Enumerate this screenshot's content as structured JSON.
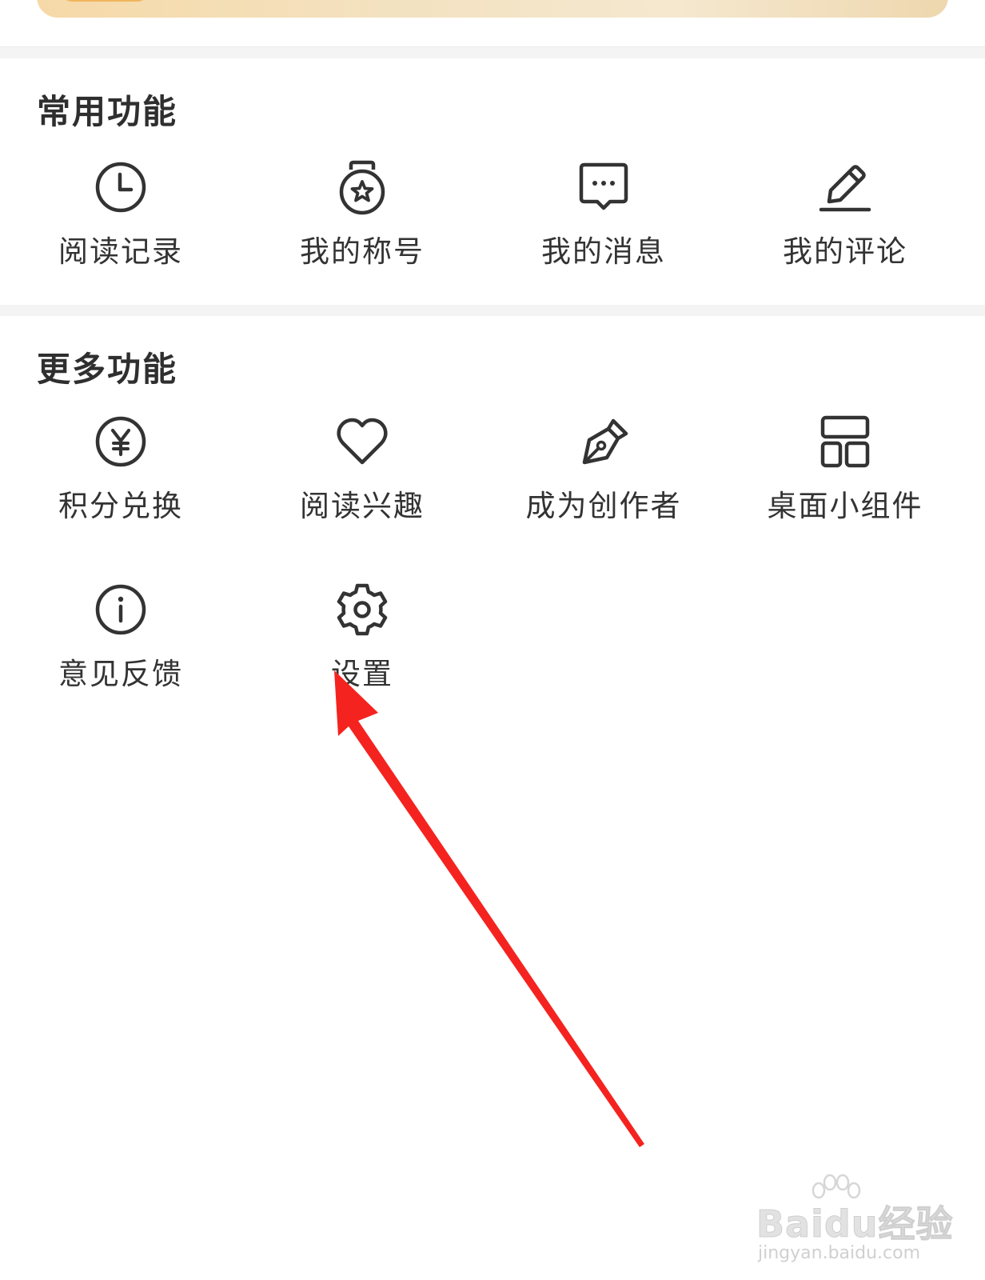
{
  "sections": [
    {
      "title": "常用功能",
      "items": [
        {
          "label": "阅读记录",
          "icon": "clock-icon"
        },
        {
          "label": "我的称号",
          "icon": "medal-icon"
        },
        {
          "label": "我的消息",
          "icon": "message-icon"
        },
        {
          "label": "我的评论",
          "icon": "edit-icon"
        }
      ]
    },
    {
      "title": "更多功能",
      "items": [
        {
          "label": "积分兑换",
          "icon": "yuan-icon"
        },
        {
          "label": "阅读兴趣",
          "icon": "heart-icon"
        },
        {
          "label": "成为创作者",
          "icon": "pen-nib-icon"
        },
        {
          "label": "桌面小组件",
          "icon": "widget-icon"
        },
        {
          "label": "意见反馈",
          "icon": "info-icon"
        },
        {
          "label": "设置",
          "icon": "gear-icon"
        }
      ]
    }
  ],
  "watermark": {
    "main": "Baidu经验",
    "sub": "jingyan.baidu.com"
  },
  "colors": {
    "icon_stroke": "#333333",
    "divider": "#f4f4f4",
    "arrow": "#f5231f"
  }
}
